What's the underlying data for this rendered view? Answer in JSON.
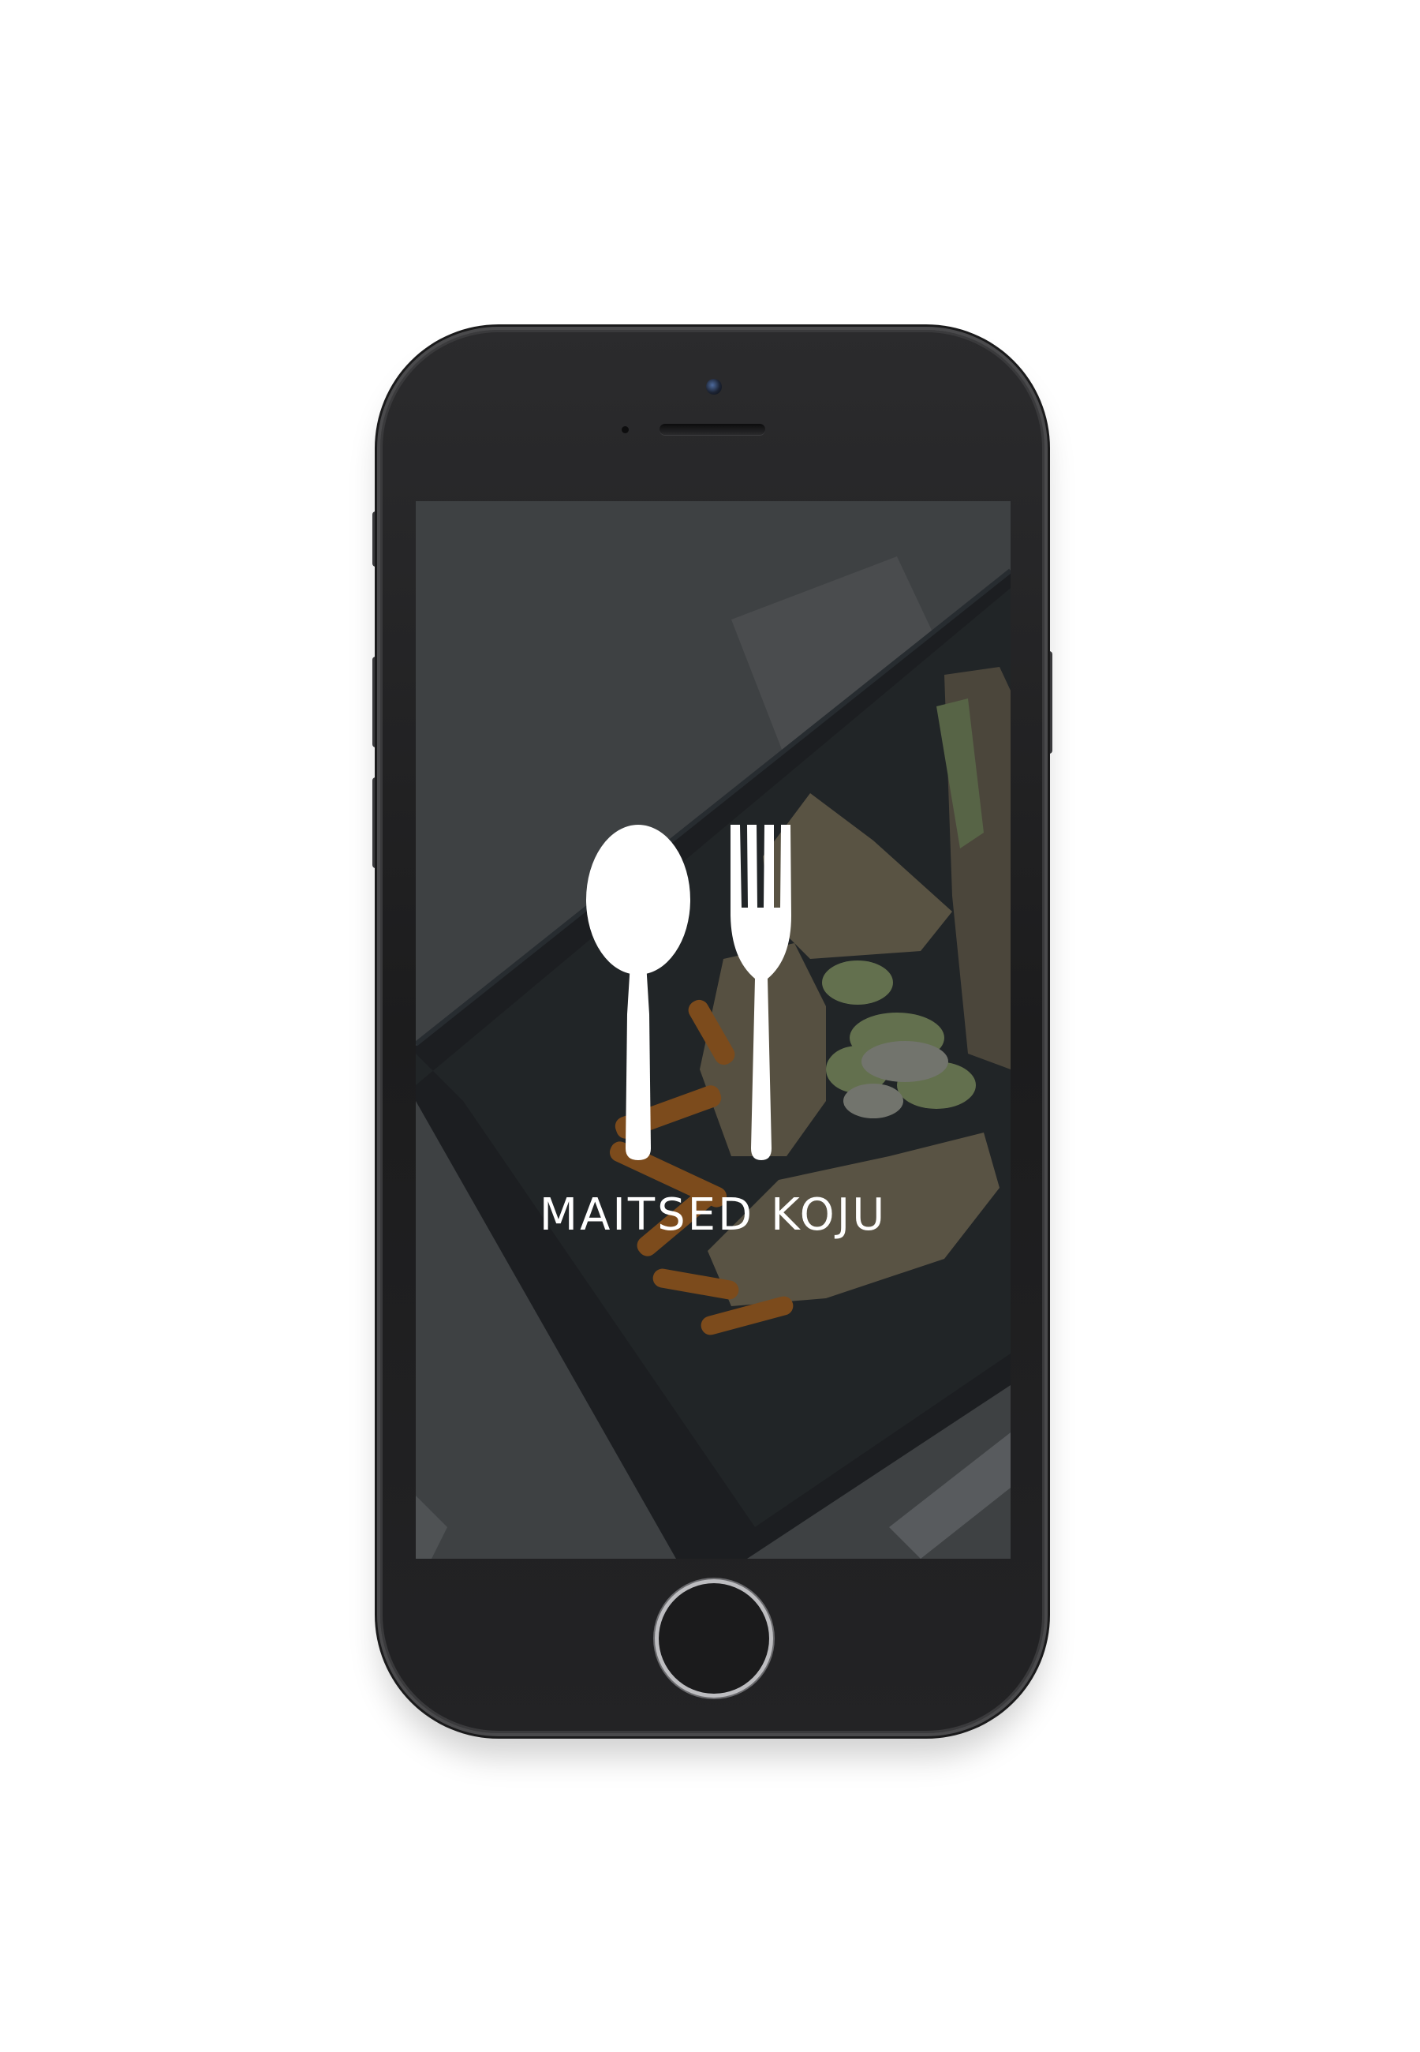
{
  "app": {
    "brand_title": "MAITSED KOJU"
  },
  "icons": {
    "logo_left": "spoon-icon",
    "logo_right": "fork-icon"
  },
  "colors": {
    "background": "#ffffff",
    "phone_body": "#1c1c1d",
    "screen_overlay": "#4a4c4f",
    "logo": "#ffffff"
  }
}
